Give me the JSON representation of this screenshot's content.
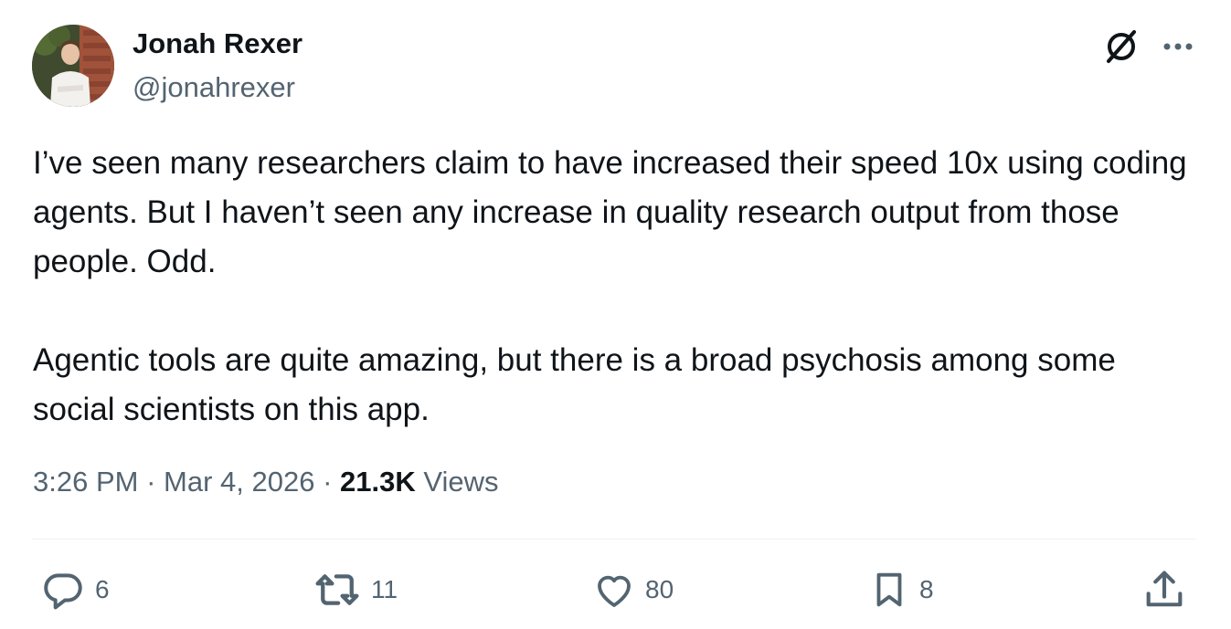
{
  "author": {
    "name": "Jonah Rexer",
    "handle": "@jonahrexer"
  },
  "icons": {
    "grok": "grok-icon",
    "more": "more-options-icon",
    "reply": "reply-icon",
    "retweet": "retweet-icon",
    "like": "like-icon",
    "bookmark": "bookmark-icon",
    "share": "share-icon"
  },
  "tweet": {
    "paragraphs": [
      "I’ve seen many researchers claim to have increased their speed 10x using coding agents. But I haven’t seen any increase in quality research output from those people. Odd.",
      "Agentic tools are quite amazing, but there is a broad psychosis among some social scientists on this app."
    ],
    "time": "3:26 PM",
    "separator": "·",
    "date": "Mar 4, 2026",
    "views_count": "21.3K",
    "views_label": "Views"
  },
  "actions": {
    "replies": "6",
    "retweets": "11",
    "likes": "80",
    "bookmarks": "8"
  },
  "colors": {
    "text_primary": "#0f1419",
    "text_secondary": "#536471",
    "divider": "#eff3f4"
  }
}
